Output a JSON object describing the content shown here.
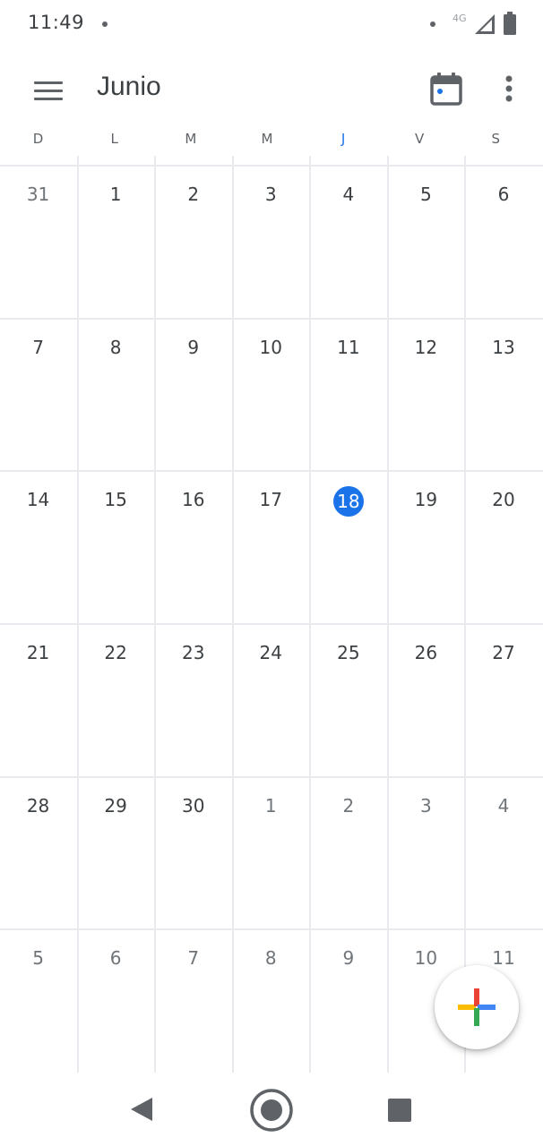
{
  "status_bar": {
    "time": "11:49",
    "network": "4G"
  },
  "header": {
    "title": "Junio",
    "menu_icon": "hamburger-menu-icon",
    "today_icon": "calendar-today-icon",
    "more_icon": "more-vert-icon"
  },
  "weekdays": [
    "D",
    "L",
    "M",
    "M",
    "J",
    "V",
    "S"
  ],
  "today_weekday_index": 4,
  "weeks": [
    [
      {
        "d": "31",
        "muted": true
      },
      {
        "d": "1"
      },
      {
        "d": "2"
      },
      {
        "d": "3"
      },
      {
        "d": "4"
      },
      {
        "d": "5"
      },
      {
        "d": "6"
      }
    ],
    [
      {
        "d": "7"
      },
      {
        "d": "8"
      },
      {
        "d": "9"
      },
      {
        "d": "10"
      },
      {
        "d": "11"
      },
      {
        "d": "12"
      },
      {
        "d": "13"
      }
    ],
    [
      {
        "d": "14"
      },
      {
        "d": "15"
      },
      {
        "d": "16"
      },
      {
        "d": "17"
      },
      {
        "d": "18",
        "today": true
      },
      {
        "d": "19"
      },
      {
        "d": "20"
      }
    ],
    [
      {
        "d": "21"
      },
      {
        "d": "22"
      },
      {
        "d": "23"
      },
      {
        "d": "24"
      },
      {
        "d": "25"
      },
      {
        "d": "26"
      },
      {
        "d": "27"
      }
    ],
    [
      {
        "d": "28"
      },
      {
        "d": "29"
      },
      {
        "d": "30"
      },
      {
        "d": "1",
        "muted": true
      },
      {
        "d": "2",
        "muted": true
      },
      {
        "d": "3",
        "muted": true
      },
      {
        "d": "4",
        "muted": true
      }
    ],
    [
      {
        "d": "5",
        "muted": true
      },
      {
        "d": "6",
        "muted": true
      },
      {
        "d": "7",
        "muted": true
      },
      {
        "d": "8",
        "muted": true
      },
      {
        "d": "9",
        "muted": true
      },
      {
        "d": "10",
        "muted": true
      },
      {
        "d": "11",
        "muted": true
      }
    ]
  ],
  "fab": {
    "icon": "plus-icon"
  },
  "nav": {
    "back_icon": "back-triangle-icon",
    "home_icon": "home-circle-icon",
    "recents_icon": "recents-square-icon"
  },
  "colors": {
    "accent": "#1a73e8",
    "google_red": "#ea4335",
    "google_blue": "#4285f4",
    "google_yellow": "#fbbc04",
    "google_green": "#34a853"
  }
}
